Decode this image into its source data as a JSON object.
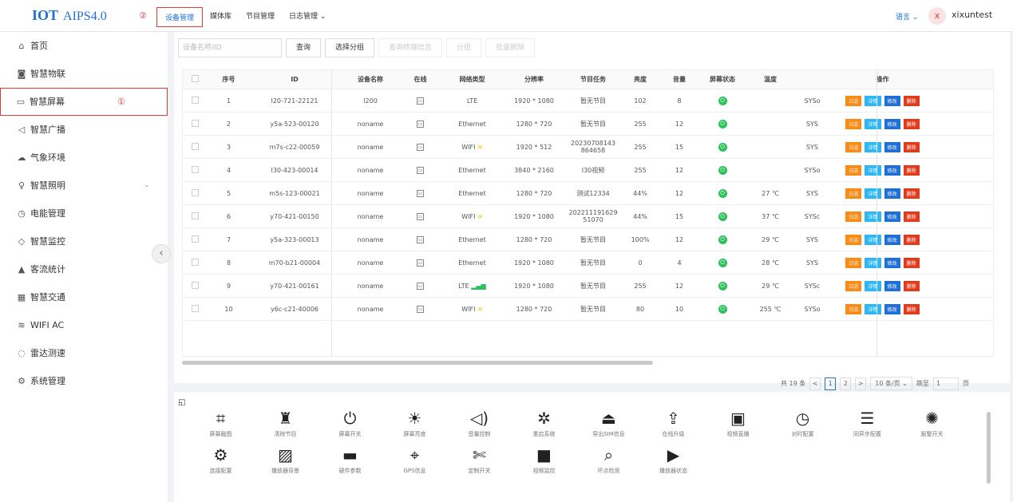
{
  "brand": {
    "logo": "IOT",
    "version": "AIPS4.0"
  },
  "markers": {
    "top": "②",
    "side": "①"
  },
  "topnav": [
    "设备管理",
    "媒体库",
    "节目管理",
    "日志管理 ⌄"
  ],
  "header": {
    "lang": "语言 ⌄",
    "avatar": "x",
    "user": "xixuntest"
  },
  "sidebar": [
    {
      "icon": "⌂",
      "label": "首页"
    },
    {
      "icon": "◙",
      "label": "智慧物联"
    },
    {
      "icon": "▭",
      "label": "智慧屏幕"
    },
    {
      "icon": "◁",
      "label": "智慧广播"
    },
    {
      "icon": "☁",
      "label": "气象环境"
    },
    {
      "icon": "♀",
      "label": "智慧照明"
    },
    {
      "icon": "◷",
      "label": "电能管理"
    },
    {
      "icon": "◇",
      "label": "智慧监控"
    },
    {
      "icon": "▲",
      "label": "客流统计"
    },
    {
      "icon": "▦",
      "label": "智慧交通"
    },
    {
      "icon": "≋",
      "label": "WIFI AC"
    },
    {
      "icon": "◌",
      "label": "雷达测速"
    },
    {
      "icon": "⚙",
      "label": "系统管理"
    }
  ],
  "toolbar": {
    "search_placeholder": "设备名称/ID",
    "query": "查询",
    "group": "选择分组",
    "terminal_info": "查询终端信息",
    "split": "分组",
    "batch_delete": "批量删除"
  },
  "table": {
    "headers": [
      "序号",
      "ID",
      "设备名称",
      "在线",
      "网络类型",
      "分辨率",
      "节目任务",
      "亮度",
      "音量",
      "屏幕状态",
      "温度",
      "",
      "操作"
    ],
    "ops": [
      "日志",
      "详情",
      "修改",
      "删除"
    ],
    "rows": [
      [
        "1",
        "I20-721-22121",
        "I200",
        "LTE",
        "1920 * 1080",
        "暂无节目",
        "102",
        "8",
        "",
        "SYSo"
      ],
      [
        "2",
        "y5a-523-00120",
        "noname",
        "Ethernet",
        "1280 * 720",
        "暂无节目",
        "255",
        "12",
        "",
        "SYS"
      ],
      [
        "3",
        "m7s-c22-00059",
        "noname",
        "WIFI",
        "1920 * 512",
        "20230708143 864658",
        "255",
        "15",
        "",
        "SYS"
      ],
      [
        "4",
        "I30-423-00014",
        "noname",
        "Ethernet",
        "3840 * 2160",
        "I30视频",
        "255",
        "12",
        "",
        "SYSo"
      ],
      [
        "5",
        "m5s-123-00021",
        "noname",
        "Ethernet",
        "1280 * 720",
        "测试12334",
        "44%",
        "12",
        "27 ℃",
        "SYS"
      ],
      [
        "6",
        "y70-421-00150",
        "noname",
        "WIFI",
        "1920 * 1080",
        "202211191629 51070",
        "44%",
        "15",
        "37 ℃",
        "SYSc"
      ],
      [
        "7",
        "y5a-323-00013",
        "noname",
        "Ethernet",
        "1280 * 720",
        "暂无节目",
        "100%",
        "12",
        "29 ℃",
        "SYS"
      ],
      [
        "8",
        "m70-b21-00004",
        "noname",
        "Ethernet",
        "1920 * 1080",
        "暂无节目",
        "0",
        "4",
        "28 ℃",
        "SYS"
      ],
      [
        "9",
        "y70-421-00161",
        "noname",
        "LTE",
        "1920 * 1080",
        "暂无节目",
        "255",
        "12",
        "29 ℃",
        "SYSc"
      ],
      [
        "10",
        "y6c-c21-40006",
        "noname",
        "WIFI",
        "1280 * 720",
        "暂无节目",
        "80",
        "10",
        "255 ℃",
        "SYSo"
      ]
    ]
  },
  "pager": {
    "total": "共 19 条",
    "prev": "<",
    "p1": "1",
    "p2": "2",
    "next": ">",
    "size": "10 条/页 ⌄",
    "jump": "跳至",
    "jump_val": "1",
    "page": "页"
  },
  "tools": [
    {
      "icon": "⌗",
      "label": "屏幕截图"
    },
    {
      "icon": "♜",
      "label": "清除节目"
    },
    {
      "icon": "⏻",
      "label": "屏幕开关"
    },
    {
      "icon": "☀",
      "label": "屏幕亮度"
    },
    {
      "icon": "◁)",
      "label": "音量控制"
    },
    {
      "icon": "✲",
      "label": "重启系统"
    },
    {
      "icon": "⏏",
      "label": "导出SIM信息"
    },
    {
      "icon": "⇪",
      "label": "在线升级"
    },
    {
      "icon": "▣",
      "label": "视频直播"
    },
    {
      "icon": "◷",
      "label": "对时配置"
    },
    {
      "icon": "☰",
      "label": "同异步配置"
    },
    {
      "icon": "✺",
      "label": "报警开关"
    },
    {
      "icon": "⚙",
      "label": "连接配置"
    },
    {
      "icon": "▨",
      "label": "播放器背景"
    },
    {
      "icon": "▬",
      "label": "硬件参数"
    },
    {
      "icon": "⌖",
      "label": "GPS信息"
    },
    {
      "icon": "✄",
      "label": "定制开关"
    },
    {
      "icon": "■",
      "label": "视频监控"
    },
    {
      "icon": "⌕",
      "label": "坏点检测"
    },
    {
      "icon": "▶",
      "label": "播放器状态"
    }
  ]
}
